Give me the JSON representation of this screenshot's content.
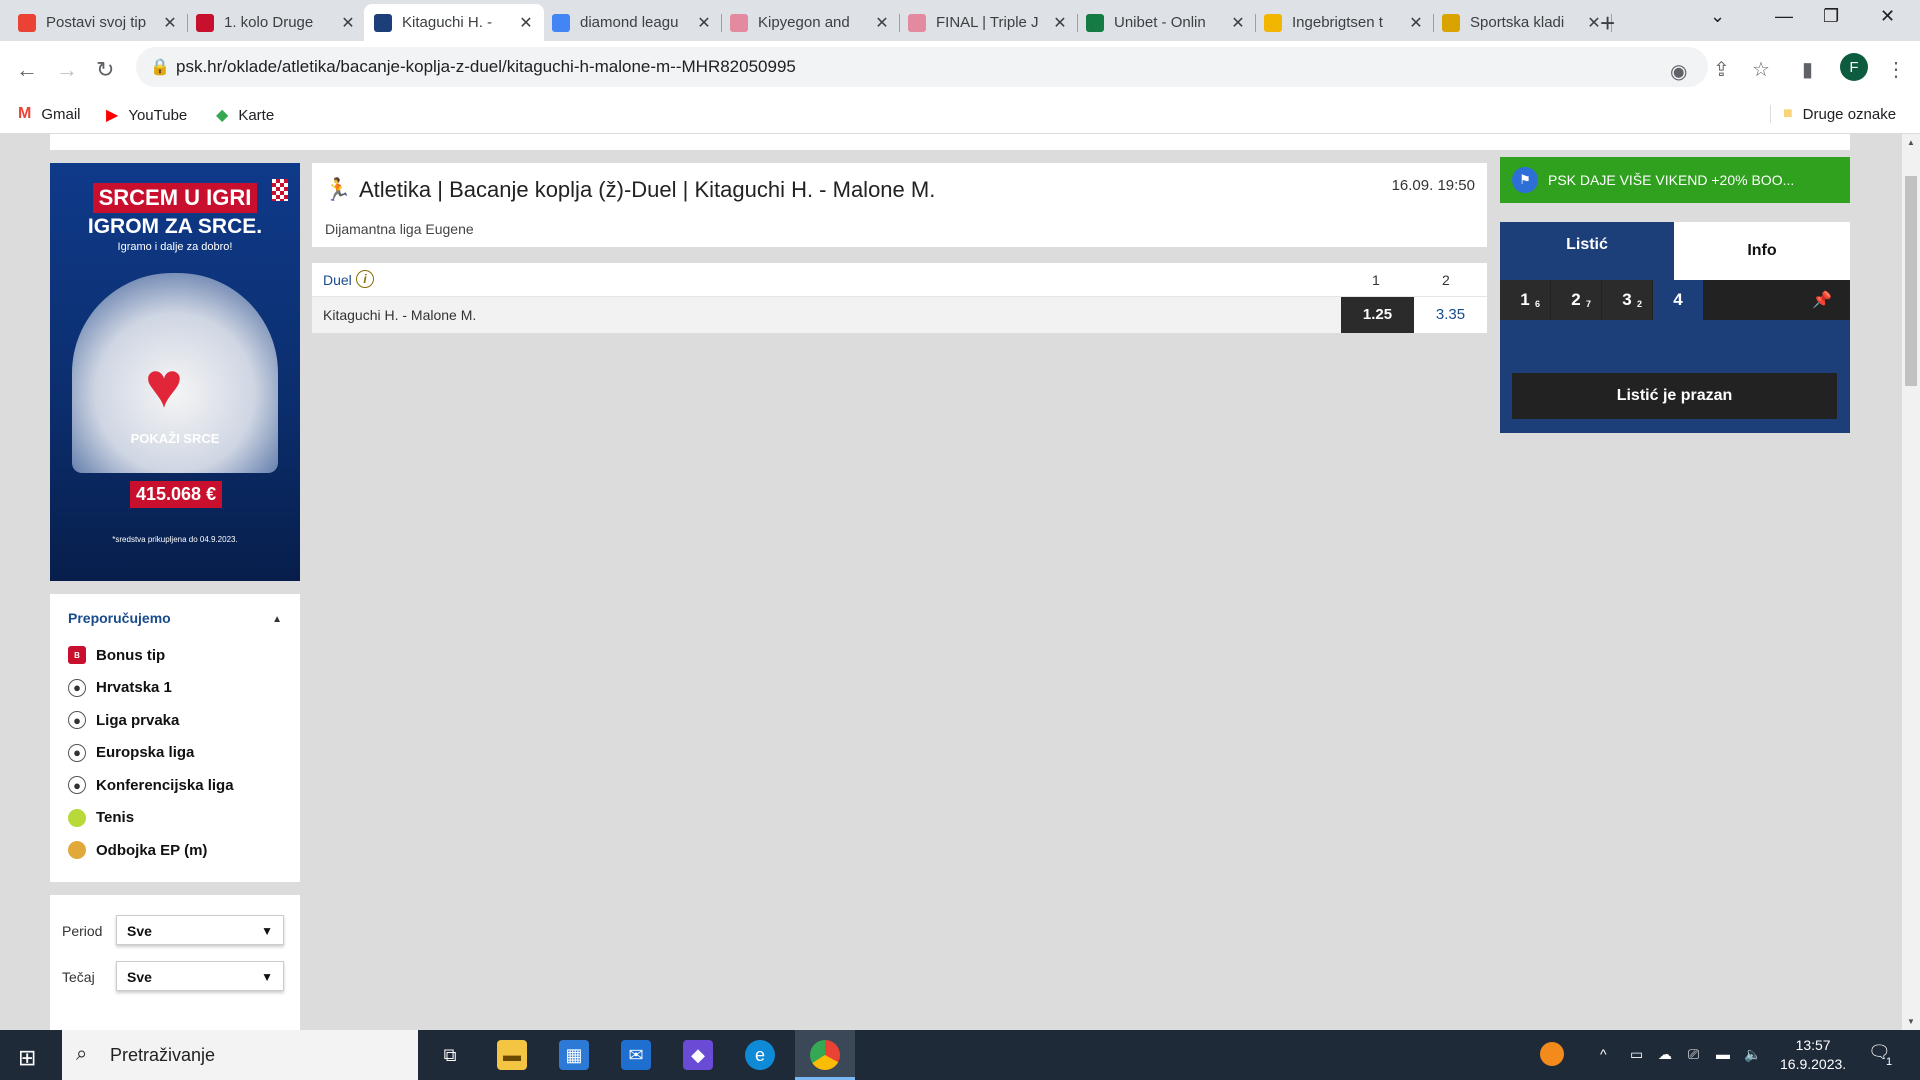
{
  "browser": {
    "tabs": [
      {
        "title": "Postavi svoj tip",
        "favicon": "gmail-icon",
        "color": "#ea4335",
        "active": false
      },
      {
        "title": "1. kolo Druge",
        "favicon": "league-icon",
        "color": "#c8102e",
        "active": false
      },
      {
        "title": "Kitaguchi H. -",
        "favicon": "psk-icon",
        "color": "#1c3f7a",
        "active": true
      },
      {
        "title": "diamond leagu",
        "favicon": "google-icon",
        "color": "#4285f4",
        "active": false
      },
      {
        "title": "Kipyegon and",
        "favicon": "worldathletics-icon",
        "color": "#e48aa0",
        "active": false
      },
      {
        "title": "FINAL | Triple J",
        "favicon": "worldathletics-icon",
        "color": "#e48aa0",
        "active": false
      },
      {
        "title": "Unibet - Onlin",
        "favicon": "unibet-icon",
        "color": "#147b45",
        "active": false
      },
      {
        "title": "Ingebrigtsen t",
        "favicon": "lr-icon",
        "color": "#f2b600",
        "active": false
      },
      {
        "title": "Sportska kladi",
        "favicon": "kladionica-icon",
        "color": "#d9a300",
        "active": false
      }
    ],
    "url": "psk.hr/oklade/atletika/bacanje-koplja-z-duel/kitaguchi-h-malone-m--MHR82050995",
    "profile_initial": "F",
    "bookmarks": [
      {
        "label": "Gmail",
        "icon": "gmail-icon"
      },
      {
        "label": "YouTube",
        "icon": "youtube-icon"
      },
      {
        "label": "Karte",
        "icon": "maps-icon"
      }
    ],
    "other_bookmarks": "Druge oznake"
  },
  "banner": {
    "line1": "SRCEM U IGRI",
    "line2": "IGROM ZA SRCE.",
    "line3": "Igramo i dalje za dobro!",
    "cta": "POKAŽI SRCE",
    "amount": "415.068 €",
    "footnote": "*sredstva prikupljena do 04.9.2023."
  },
  "recommend": {
    "heading": "Preporučujemo",
    "items": [
      {
        "label": "Bonus tip",
        "icon": "bonus-icon"
      },
      {
        "label": "Hrvatska 1",
        "icon": "football-icon"
      },
      {
        "label": "Liga prvaka",
        "icon": "football-icon"
      },
      {
        "label": "Europska liga",
        "icon": "football-icon"
      },
      {
        "label": "Konferencijska liga",
        "icon": "football-icon"
      },
      {
        "label": "Tenis",
        "icon": "tennis-icon"
      },
      {
        "label": "Odbojka EP (m)",
        "icon": "volleyball-icon"
      }
    ]
  },
  "filters": {
    "period_label": "Period",
    "period_value": "Sve",
    "odds_label": "Tečaj",
    "odds_value": "Sve"
  },
  "event": {
    "title": "Atletika | Bacanje koplja (ž)-Duel | Kitaguchi H. - Malone M.",
    "datetime": "16.09. 19:50",
    "league": "Dijamantna liga Eugene"
  },
  "market": {
    "name": "Duel",
    "col1": "1",
    "col2": "2",
    "match": "Kitaguchi H. - Malone M.",
    "odd1": "1.25",
    "odd2": "3.35"
  },
  "promo": {
    "text": "PSK DAJE VIŠE VIKEND +20% BOO..."
  },
  "slip": {
    "tab_left": "Listić",
    "tab_right": "Info",
    "numbers": [
      {
        "n": "1",
        "sup": "6"
      },
      {
        "n": "2",
        "sup": "7"
      },
      {
        "n": "3",
        "sup": "2"
      },
      {
        "n": "4",
        "sup": ""
      }
    ],
    "empty": "Listić je prazan"
  },
  "taskbar": {
    "search_placeholder": "Pretraživanje",
    "time": "13:57",
    "date": "16.9.2023.",
    "notifications": "1"
  }
}
